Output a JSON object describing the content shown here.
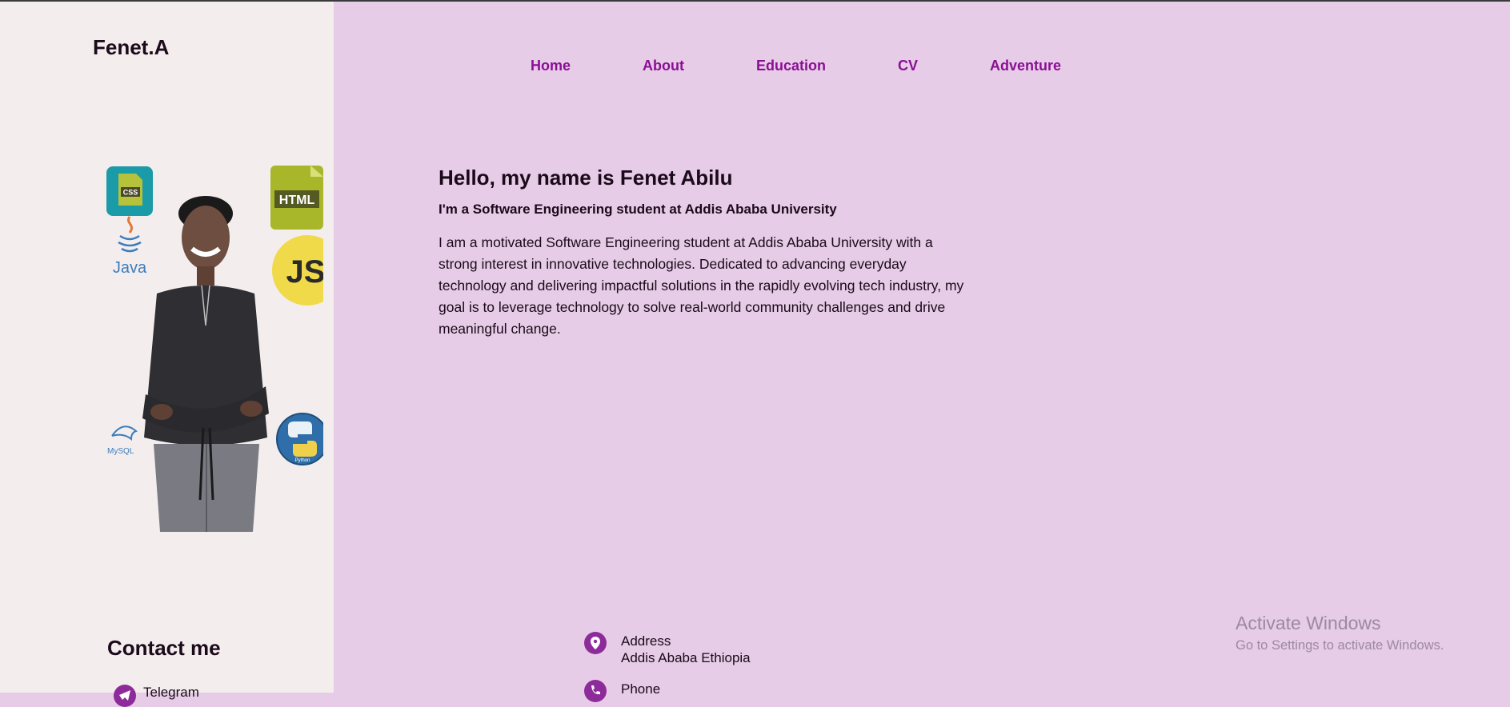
{
  "site": {
    "logo": "Fenet.A"
  },
  "nav": {
    "items": [
      {
        "label": "Home"
      },
      {
        "label": "About"
      },
      {
        "label": "Education"
      },
      {
        "label": "CV"
      },
      {
        "label": "Adventure"
      }
    ]
  },
  "profile": {
    "badges": {
      "css": "CSS",
      "java": "Java",
      "html": "HTML",
      "js": "JS",
      "mysql": "MySQL",
      "python": "Python"
    }
  },
  "hero": {
    "greeting": "Hello, my name is Fenet Abilu",
    "subtitle": "I'm a Software Engineering student at Addis Ababa University",
    "bio": "I am a motivated Software Engineering student at Addis Ababa University with a strong interest in innovative technologies. Dedicated to advancing everyday technology and delivering impactful solutions in the rapidly evolving tech industry, my goal is to leverage technology to solve real-world community challenges and drive meaningful change."
  },
  "contact": {
    "title": "Contact me",
    "telegram_label": "Telegram",
    "address_label": "Address",
    "address_value": "Addis Ababa Ethiopia",
    "phone_label": "Phone"
  },
  "os_overlay": {
    "title": "Activate Windows",
    "subtitle": "Go to Settings to activate Windows."
  },
  "colors": {
    "sidebar_bg": "#f4eded",
    "main_bg": "#e6cce6",
    "nav_link": "#8b0f96",
    "icon_accent": "#8e2b9a",
    "text": "#1a0a1a"
  }
}
